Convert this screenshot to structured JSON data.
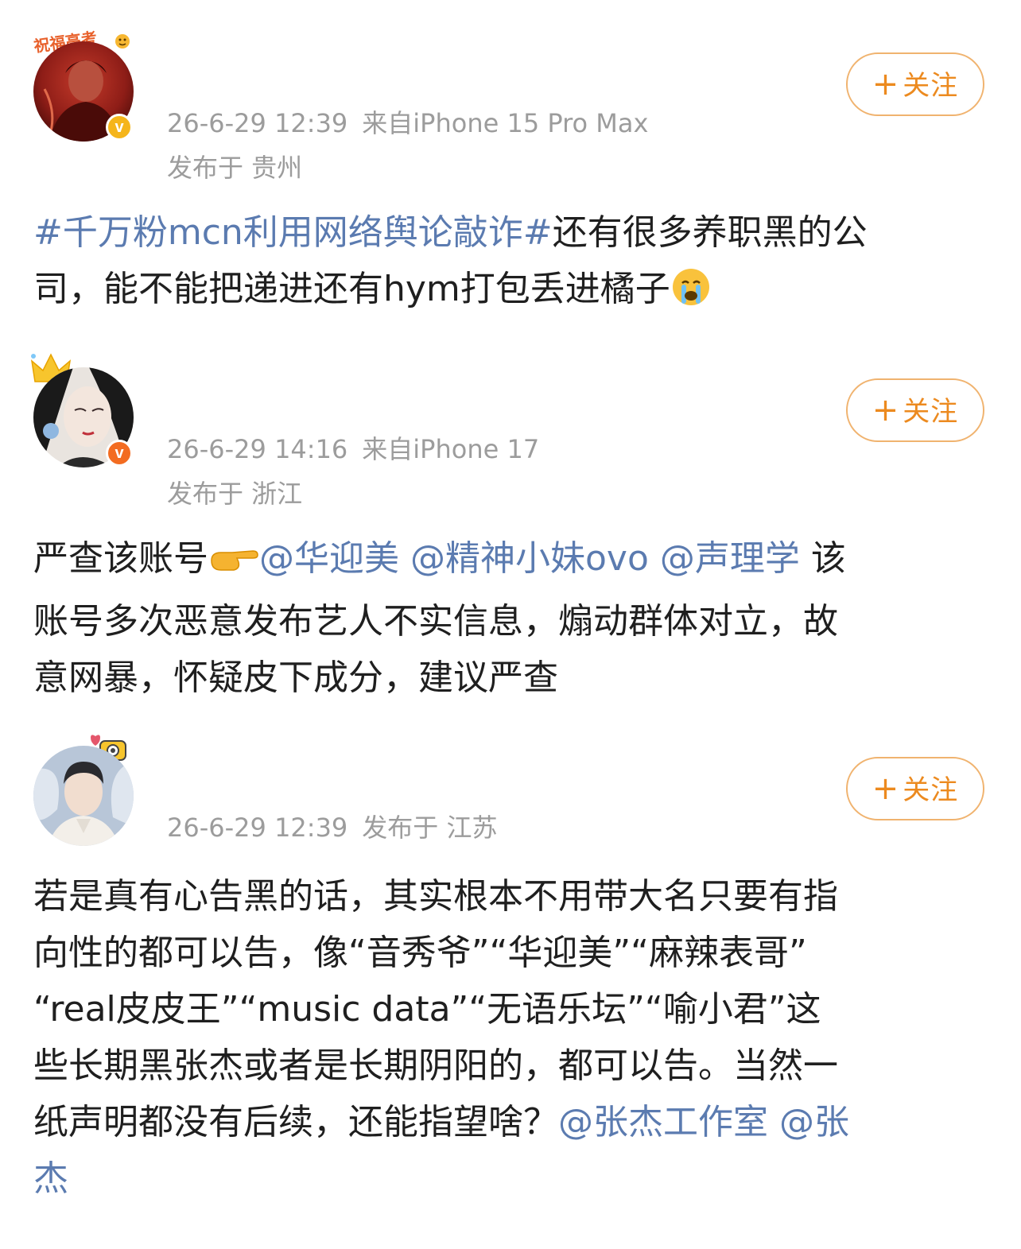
{
  "posts": [
    {
      "avatar_badge": "祝福高考",
      "time": "26-6-29 12:39",
      "source": "来自iPhone 15 Pro Max",
      "location": "发布于 贵州",
      "follow_label": "关注",
      "verified_color": "#f5b51b",
      "content": {
        "hashtag": "#千万粉mcn利用网络舆论敲诈#",
        "text1": "还有很多养职黑的公",
        "text2": "司，能不能把递进还有hym打包丢进橘子",
        "emoji": "crying-emoji"
      }
    },
    {
      "time": "26-6-29 14:16",
      "source": "来自iPhone 17",
      "location": "发布于 浙江",
      "follow_label": "关注",
      "verified_color": "#f36c21",
      "content": {
        "line1_prefix": "严查该账号",
        "emoji": "pointing-hand-emoji",
        "mention1": "@华迎美",
        "mention2": "@精神小妹ovo",
        "mention3": "@声理学",
        "line1_suffix": " 该",
        "line2": "账号多次恶意发布艺人不实信息，煽动群体对立，故",
        "line3": "意网暴，怀疑皮下成分，建议严查"
      }
    },
    {
      "time": "26-6-29 12:39",
      "location": "发布于 江苏",
      "follow_label": "关注",
      "content": {
        "line1": "若是真有心告黑的话，其实根本不用带大名只要有指",
        "line2": "向性的都可以告，像“音秀爷”“华迎美”“麻辣表哥”",
        "line3": "“real皮皮王”“music data”“无语乐坛”“喻小君”这",
        "line4": "些长期黑张杰或者是长期阴阳的，都可以告。当然一",
        "line5_prefix": "纸声明都没有后续，还能指望啥？",
        "mention1": "@张杰工作室",
        "mention2": "@张",
        "line6": "杰"
      }
    }
  ],
  "colors": {
    "link": "#5b7bb0",
    "follow_border": "#f0b36f",
    "follow_text": "#ec8a1f",
    "meta_text": "#9c9c9c"
  }
}
